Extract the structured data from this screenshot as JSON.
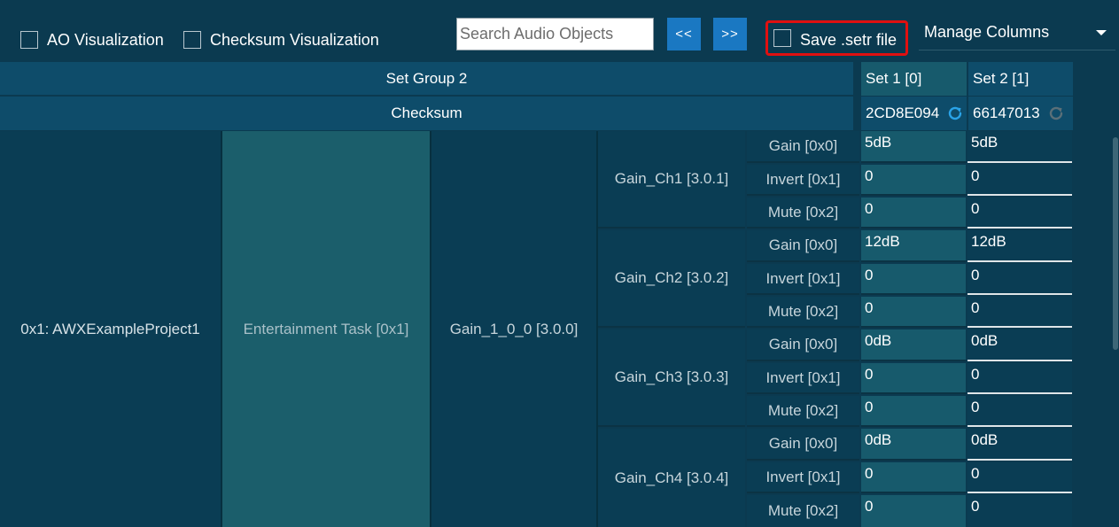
{
  "toolbar": {
    "ao_visualization_label": "AO Visualization",
    "checksum_visualization_label": "Checksum Visualization",
    "search_placeholder": "Search Audio Objects",
    "prev_label": "<<",
    "next_label": ">>",
    "save_setr_label": "Save .setr file",
    "manage_columns_label": "Manage Columns"
  },
  "header": {
    "set_group_label": "Set Group 2",
    "checksum_label": "Checksum",
    "sets": [
      {
        "name": "Set 1 [0]",
        "checksum": "2CD8E094"
      },
      {
        "name": "Set 2 [1]",
        "checksum": "66147013"
      }
    ]
  },
  "tree": {
    "project": "0x1: AWXExampleProject1",
    "task": "Entertainment Task [0x1]",
    "module": "Gain_1_0_0 [3.0.0]"
  },
  "channels": [
    {
      "name": "Gain_Ch1 [3.0.1]",
      "rows": [
        {
          "prop": "Gain [0x0]",
          "v1": "5dB",
          "v2": "5dB"
        },
        {
          "prop": "Invert [0x1]",
          "v1": "0",
          "v2": "0"
        },
        {
          "prop": "Mute [0x2]",
          "v1": "0",
          "v2": "0"
        }
      ]
    },
    {
      "name": "Gain_Ch2 [3.0.2]",
      "rows": [
        {
          "prop": "Gain [0x0]",
          "v1": "12dB",
          "v2": "12dB"
        },
        {
          "prop": "Invert [0x1]",
          "v1": "0",
          "v2": "0"
        },
        {
          "prop": "Mute [0x2]",
          "v1": "0",
          "v2": "0"
        }
      ]
    },
    {
      "name": "Gain_Ch3 [3.0.3]",
      "rows": [
        {
          "prop": "Gain [0x0]",
          "v1": "0dB",
          "v2": "0dB"
        },
        {
          "prop": "Invert [0x1]",
          "v1": "0",
          "v2": "0"
        },
        {
          "prop": "Mute [0x2]",
          "v1": "0",
          "v2": "0"
        }
      ]
    },
    {
      "name": "Gain_Ch4 [3.0.4]",
      "rows": [
        {
          "prop": "Gain [0x0]",
          "v1": "0dB",
          "v2": "0dB"
        },
        {
          "prop": "Invert [0x1]",
          "v1": "0",
          "v2": "0"
        },
        {
          "prop": "Mute [0x2]",
          "v1": "0",
          "v2": "0"
        }
      ]
    }
  ],
  "colors": {
    "background": "#0b3a50",
    "header": "#0e4c6a",
    "task_column": "#1b5e6b",
    "set1_column": "#175a6c",
    "accent_button": "#1a78c2",
    "highlight_border": "#e01010",
    "refresh_active": "#2aa3e8",
    "refresh_inactive": "#5a6f78"
  },
  "icons": [
    "checkbox",
    "refresh-icon",
    "chevron-down-icon"
  ]
}
